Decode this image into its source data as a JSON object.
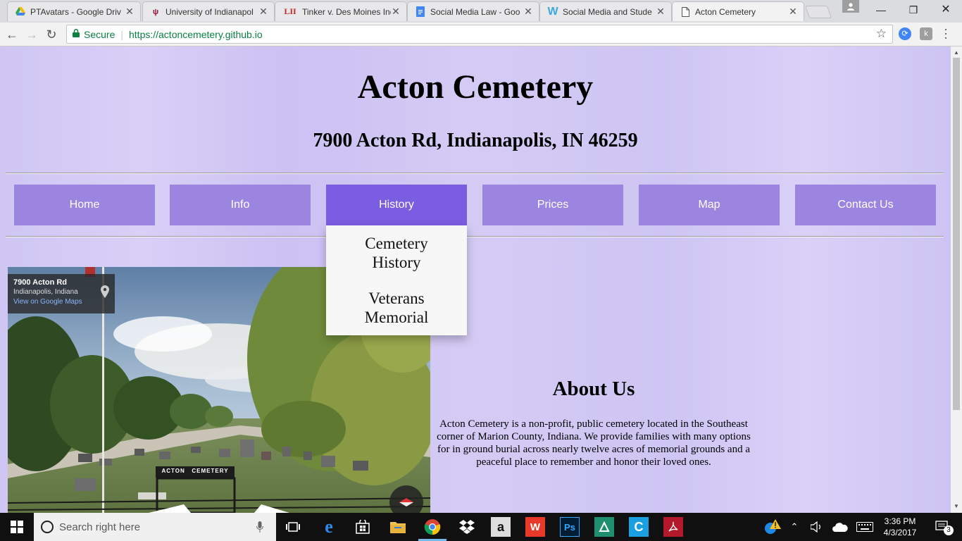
{
  "browser": {
    "tabs": [
      {
        "title": "PTAvatars - Google Driv",
        "favicon": "google-drive-icon"
      },
      {
        "title": "University of Indianapol",
        "favicon": "university-icon"
      },
      {
        "title": "Tinker v. Des Moines Ind",
        "favicon": "lii-icon",
        "favicon_text": "LII"
      },
      {
        "title": "Social Media Law - Goo",
        "favicon": "google-docs-icon"
      },
      {
        "title": "Social Media and Stude",
        "favicon": "weebly-icon",
        "favicon_text": "W"
      },
      {
        "title": "Acton Cemetery",
        "favicon": "document-icon",
        "active": true
      }
    ],
    "secure_label": "Secure",
    "url": "https://actoncemetery.github.io",
    "colors": {
      "secure": "#0b8043"
    }
  },
  "site": {
    "title": "Acton Cemetery",
    "address": "7900 Acton Rd, Indianapolis, IN 46259",
    "nav": [
      {
        "label": "Home"
      },
      {
        "label": "Info"
      },
      {
        "label": "History",
        "active": true
      },
      {
        "label": "Prices"
      },
      {
        "label": "Map"
      },
      {
        "label": "Contact Us"
      }
    ],
    "dropdown": [
      {
        "label": "Cemetery History"
      },
      {
        "label": "Veterans Memorial"
      }
    ],
    "colors": {
      "nav": "#9c85e0",
      "nav_active": "#7a5de0",
      "background": "#d1c8f5"
    }
  },
  "streetview": {
    "location_name": "7900 Acton Rd",
    "location_sub": "Indianapolis, Indiana",
    "link": "View on Google Maps",
    "gate_sign": "ACTON   CEMETERY"
  },
  "about": {
    "title": "About Us",
    "text": "Acton Cemetery is a non-profit, public cemetery located in the Southeast corner of Marion County, Indiana. We provide families with many options for in ground burial across nearly twelve acres of memorial grounds and a peaceful place to remember and honor their loved ones."
  },
  "taskbar": {
    "search_placeholder": "Search right here",
    "time": "3:36 PM",
    "date": "4/3/2017",
    "notification_count": "3"
  }
}
